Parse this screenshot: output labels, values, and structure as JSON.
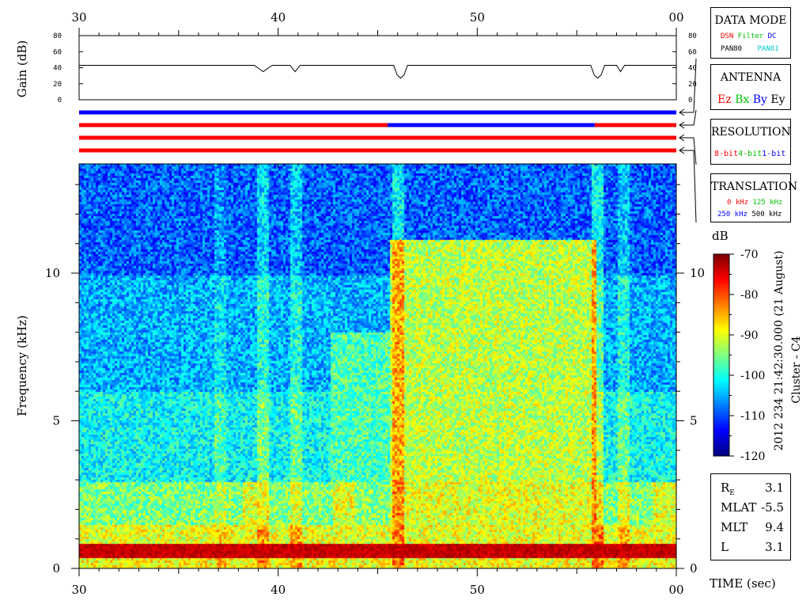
{
  "chart_data": {
    "type": "heatmap",
    "xlabel": "TIME (sec)",
    "ylabel": "Frequency (kHz)",
    "x_tick_labels": [
      "30",
      "40",
      "50",
      "00"
    ],
    "y_tick_labels": [
      "0",
      "5",
      "10"
    ],
    "xlim": [
      30,
      60
    ],
    "ylim": [
      0,
      13.7
    ],
    "colorbar": {
      "label": "dB",
      "min": -120,
      "max": -70,
      "tick_labels": [
        "-70",
        "-80",
        "-90",
        "-100",
        "-110",
        "-120"
      ]
    },
    "title_vertical": "2012 234 21:42:30.000 (21 August)",
    "subtitle_vertical": "Cluster - C4",
    "gain_panel": {
      "ylabel": "Gain (dB)",
      "tick_labels": [
        "80",
        "60",
        "40",
        "20",
        "0"
      ],
      "ylim": [
        0,
        80
      ],
      "baseline_db": 43,
      "dips": [
        {
          "start": 38.8,
          "end": 39.7,
          "min_db": 35
        },
        {
          "start": 40.6,
          "end": 41.1,
          "min_db": 35
        },
        {
          "start": 45.8,
          "end": 46.5,
          "min_db": 27
        },
        {
          "start": 55.7,
          "end": 56.4,
          "min_db": 27
        },
        {
          "start": 57.0,
          "end": 57.4,
          "min_db": 35
        }
      ]
    },
    "status_bars": [
      {
        "name": "data_mode",
        "segments": [
          {
            "start": 30,
            "end": 60,
            "color": "#0000ff"
          }
        ]
      },
      {
        "name": "antenna",
        "segments": [
          {
            "start": 30,
            "end": 45.5,
            "color": "#ff0000"
          },
          {
            "start": 45.5,
            "end": 55.9,
            "color": "#0000ff"
          },
          {
            "start": 55.9,
            "end": 60,
            "color": "#ff0000"
          }
        ]
      },
      {
        "name": "resolution",
        "segments": [
          {
            "start": 30,
            "end": 60,
            "color": "#ff0000"
          }
        ]
      },
      {
        "name": "translation",
        "segments": [
          {
            "start": 30,
            "end": 60,
            "color": "#ff0000"
          }
        ]
      }
    ]
  },
  "legend_boxes": {
    "data_mode": {
      "title": "DATA MODE",
      "items": [
        {
          "text": "DSN",
          "color": "#ff0000"
        },
        {
          "text": "Filter",
          "color": "#00c000"
        },
        {
          "text": "DC",
          "color": "#0000ff"
        },
        {
          "text": "PAN80",
          "color": "#000000"
        },
        {
          "text": "PAN81",
          "color": "#00c8c8"
        }
      ]
    },
    "antenna": {
      "title": "ANTENNA",
      "items": [
        {
          "text": "Ez",
          "color": "#ff0000"
        },
        {
          "text": "Bx",
          "color": "#00c000"
        },
        {
          "text": "By",
          "color": "#0000ff"
        },
        {
          "text": "Ey",
          "color": "#000000"
        }
      ]
    },
    "resolution": {
      "title": "RESOLUTION",
      "items": [
        {
          "text": "8-bit",
          "color": "#ff0000"
        },
        {
          "text": "4-bit",
          "color": "#00c000"
        },
        {
          "text": "1-bit",
          "color": "#0000ff"
        }
      ]
    },
    "translation": {
      "title": "TRANSLATION",
      "items": [
        {
          "text": "0 kHz",
          "color": "#ff0000"
        },
        {
          "text": "125 kHz",
          "color": "#00c000"
        },
        {
          "text": "250 kHz",
          "color": "#0000ff"
        },
        {
          "text": "500 kHz",
          "color": "#000000"
        }
      ]
    }
  },
  "orbit_info": {
    "rows": [
      {
        "label": "R",
        "sub": "E",
        "value": "3.1"
      },
      {
        "label": "MLAT",
        "sub": "",
        "value": "-5.5"
      },
      {
        "label": "MLT",
        "sub": "",
        "value": "9.4"
      },
      {
        "label": "L",
        "sub": "",
        "value": "3.1"
      }
    ]
  }
}
